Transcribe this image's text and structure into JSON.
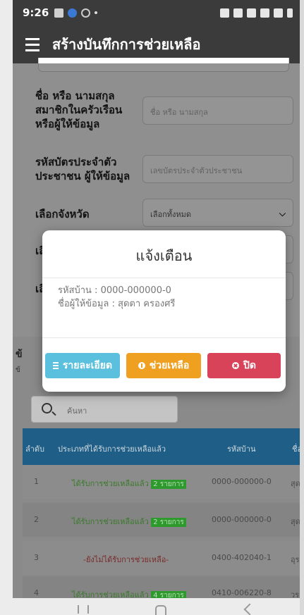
{
  "status": {
    "time": "9:26"
  },
  "appbar": {
    "title": "สร้างบันทึกการช่วยเหลือ"
  },
  "form": {
    "name_label": "ชื่อ หรือ นามสกุล สมาชิกในครัวเรือน หรือผู้ให้ข้อมูล",
    "name_placeholder": "ชื่อ หรือ นามสกุล",
    "id_label": "รหัสบัตรประจำตัว ประชาชน ผู้ให้ข้อมูล",
    "id_placeholder": "เลขบัตรประจำตัวประชาชน",
    "province_label": "เลือกจังหวัด",
    "province_value": "เลือกทั้งหมด",
    "label4": "เลื",
    "label5": "เลื"
  },
  "section": {
    "heading": "ข้",
    "sub": "ข้",
    "search_placeholder": "ค้นหา"
  },
  "table": {
    "headers": {
      "no": "ลำดับ",
      "type": "ประเภทที่ได้รับการช่วยเหลือแล้ว",
      "house": "รหัสบ้าน",
      "name": "ชื่อ"
    },
    "rows": [
      {
        "no": "1",
        "status": "ได้รับการช่วยเหลือแล้ว",
        "badge": "2 รายการ",
        "house": "0000-000000-0",
        "name": "สุด"
      },
      {
        "no": "2",
        "status": "ได้รับการช่วยเหลือแล้ว",
        "badge": "2 รายการ",
        "house": "0000-000000-0",
        "name": "สุด"
      },
      {
        "no": "3",
        "status": "-ยังไม่ได้รับการช่วยเหลือ-",
        "badge": "",
        "house": "0400-402040-1",
        "name": "อุร"
      },
      {
        "no": "4",
        "status": "ได้รับการช่วยเหลือแล้ว",
        "badge": "4 รายการ",
        "house": "0410-006220-8",
        "name": "วร"
      }
    ]
  },
  "modal": {
    "title": "แจ้งเตือน",
    "house_line": "รหัสบ้าน : 0000-000000-0",
    "informant_line": "ชื่อผู้ให้ข้อมูล : สุดตา ครองศรี",
    "detail_button": "รายละเอียด",
    "help_button": "ช่วยเหลือ",
    "close_button": "ปิด"
  },
  "colors": {
    "appbar": "#3b3b3b",
    "detail": "#5bc0de",
    "help": "#f0a020",
    "close": "#d9435a",
    "table_header": "#1f5f87"
  }
}
